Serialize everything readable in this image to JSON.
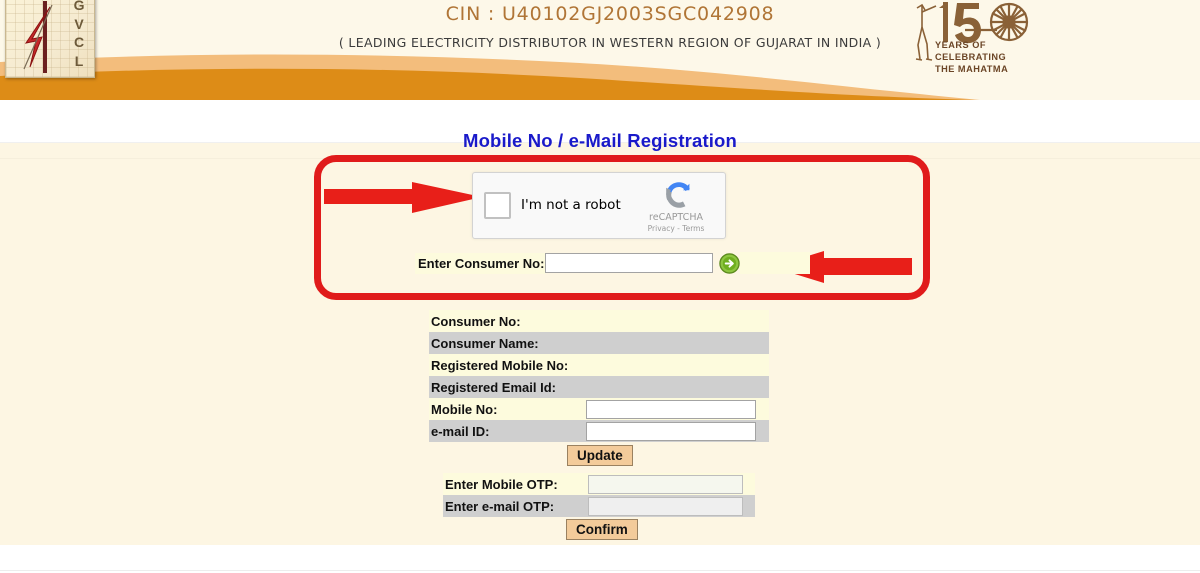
{
  "header": {
    "logo_letters": [
      "G",
      "V",
      "C",
      "L"
    ],
    "cin": "CIN : U40102GJ2003SGC042908",
    "tagline": "( LEADING ELECTRICITY DISTRIBUTOR IN WESTERN REGION OF GUJARAT IN INDIA )",
    "gandhi_line1": "YEARS OF",
    "gandhi_line2": "CELEBRATING",
    "gandhi_line3": "THE MAHATMA",
    "gandhi_number": "150"
  },
  "page": {
    "title": "Mobile No / e-Mail Registration"
  },
  "recaptcha": {
    "label": "I'm not a robot",
    "brand": "reCAPTCHA",
    "terms": "Privacy - Terms",
    "checked": false
  },
  "consumer_lookup": {
    "label": "Enter Consumer No:",
    "value": "",
    "placeholder": "",
    "go_icon": "green-arrow-right-icon"
  },
  "details_table": {
    "rows": [
      {
        "label": "Consumer No:",
        "value": "",
        "type": "text",
        "shade": "odd"
      },
      {
        "label": "Consumer Name:",
        "value": "",
        "type": "text",
        "shade": "even"
      },
      {
        "label": "Registered Mobile No:",
        "value": "",
        "type": "text",
        "shade": "odd"
      },
      {
        "label": "Registered Email Id:",
        "value": "",
        "type": "text",
        "shade": "even"
      },
      {
        "label": "Mobile No:",
        "value": "",
        "type": "input",
        "shade": "odd"
      },
      {
        "label": "e-mail ID:",
        "value": "",
        "type": "input",
        "shade": "even"
      }
    ]
  },
  "update_button": {
    "label": "Update"
  },
  "otp_table": {
    "rows": [
      {
        "label": "Enter Mobile OTP:",
        "value": "",
        "shade": "odd"
      },
      {
        "label": "Enter e-mail OTP:",
        "value": "",
        "shade": "even"
      }
    ]
  },
  "confirm_button": {
    "label": "Confirm"
  },
  "annotation": {
    "box_color": "#e01b1b",
    "arrow_color": "#e81f19",
    "arrow_count": 2
  },
  "colors": {
    "title": "#1a1aca",
    "banner_cream": "#fdf8e9",
    "page_cream": "#fdf6e3",
    "wave_light": "#f3bd7c",
    "wave_dark": "#dd8c17",
    "row_yellow": "#fdfbdd",
    "row_gray": "#cfcfcf",
    "button_peach": "#f3cb9a",
    "cin_brown": "#b07536"
  }
}
